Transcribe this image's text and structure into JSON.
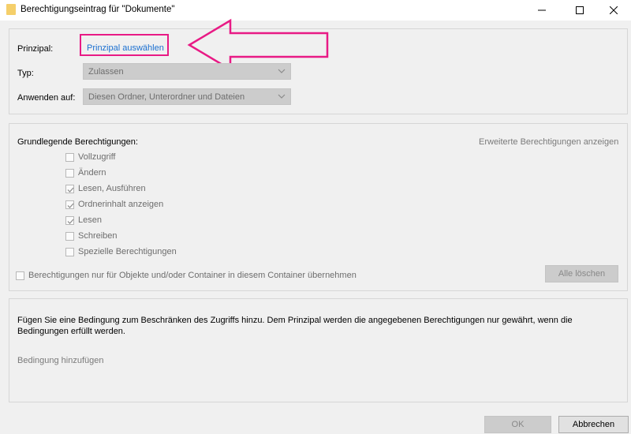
{
  "window": {
    "title": "Berechtigungseintrag für \"Dokumente\"",
    "controls": [
      "minimize-icon",
      "maximize-icon",
      "close-icon"
    ]
  },
  "principal_section": {
    "principal_label": "Prinzipal:",
    "principal_link": "Prinzipal auswählen",
    "type_label": "Typ:",
    "type_value": "Zulassen",
    "apply_label": "Anwenden auf:",
    "apply_value": "Diesen Ordner, Unterordner und Dateien",
    "annotation_color": "#e81a85"
  },
  "permissions_section": {
    "heading": "Grundlegende Berechtigungen:",
    "advanced_link": "Erweiterte Berechtigungen anzeigen",
    "permissions": [
      {
        "label": "Vollzugriff",
        "checked": false
      },
      {
        "label": "Ändern",
        "checked": false
      },
      {
        "label": "Lesen, Ausführen",
        "checked": true
      },
      {
        "label": "Ordnerinhalt anzeigen",
        "checked": true
      },
      {
        "label": "Lesen",
        "checked": true
      },
      {
        "label": "Schreiben",
        "checked": false
      },
      {
        "label": "Spezielle Berechtigungen",
        "checked": false
      }
    ],
    "inherit_label": "Berechtigungen nur für Objekte und/oder Container in diesem Container übernehmen",
    "clear_all_label": "Alle löschen"
  },
  "condition_section": {
    "description": "Fügen Sie eine Bedingung zum Beschränken des Zugriffs hinzu. Dem Prinzipal werden die angegebenen Berechtigungen nur gewährt, wenn die Bedingungen erfüllt werden.",
    "add_condition_link": "Bedingung hinzufügen"
  },
  "footer": {
    "ok_label": "OK",
    "cancel_label": "Abbrechen"
  }
}
